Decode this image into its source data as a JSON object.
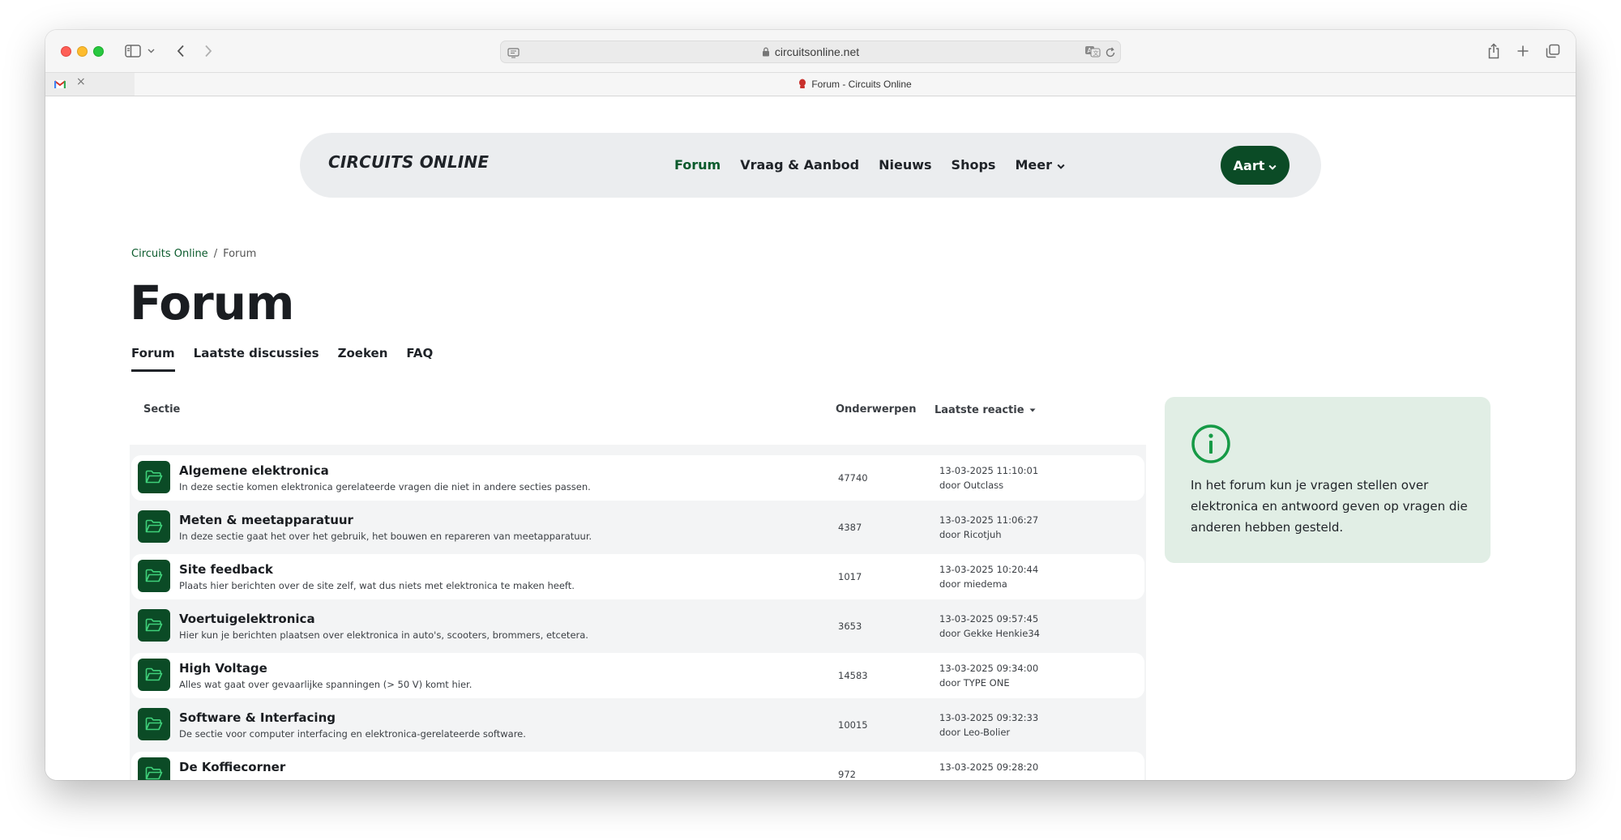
{
  "browser": {
    "url": "circuitsonline.net",
    "tab_title": "Forum - Circuits Online",
    "inactive_tab_close": "×"
  },
  "site": {
    "logo": "CIRCUITS ONLINE",
    "nav": [
      {
        "label": "Forum",
        "active": true
      },
      {
        "label": "Vraag & Aanbod",
        "active": false
      },
      {
        "label": "Nieuws",
        "active": false
      },
      {
        "label": "Shops",
        "active": false
      },
      {
        "label": "Meer",
        "active": false
      }
    ],
    "user_button": "Aart",
    "accent_color": "#0b4b26"
  },
  "breadcrumb": {
    "home": "Circuits Online",
    "separator": "/",
    "current": "Forum"
  },
  "page_title": "Forum",
  "subtabs": [
    {
      "label": "Forum",
      "active": true
    },
    {
      "label": "Laatste discussies",
      "active": false
    },
    {
      "label": "Zoeken",
      "active": false
    },
    {
      "label": "FAQ",
      "active": false
    }
  ],
  "table": {
    "headers": {
      "section": "Sectie",
      "topics": "Onderwerpen",
      "last_reply": "Laatste reactie"
    },
    "rows": [
      {
        "title": "Algemene elektronica",
        "desc": "In deze sectie komen elektronica gerelateerde vragen die niet in andere secties passen.",
        "count": "47740",
        "date": "13-03-2025 11:10:01",
        "by": "door Outclass"
      },
      {
        "title": "Meten & meetapparatuur",
        "desc": "In deze sectie gaat het over het gebruik, het bouwen en repareren van meetapparatuur.",
        "count": "4387",
        "date": "13-03-2025 11:06:27",
        "by": "door Ricotjuh"
      },
      {
        "title": "Site feedback",
        "desc": "Plaats hier berichten over de site zelf, wat dus niets met elektronica te maken heeft.",
        "count": "1017",
        "date": "13-03-2025 10:20:44",
        "by": "door miedema"
      },
      {
        "title": "Voertuigelektronica",
        "desc": "Hier kun je berichten plaatsen over elektronica in auto's, scooters, brommers, etcetera.",
        "count": "3653",
        "date": "13-03-2025 09:57:45",
        "by": "door Gekke Henkie34"
      },
      {
        "title": "High Voltage",
        "desc": "Alles wat gaat over gevaarlijke spanningen (> 50 V) komt hier.",
        "count": "14583",
        "date": "13-03-2025 09:34:00",
        "by": "door TYPE ONE"
      },
      {
        "title": "Software & Interfacing",
        "desc": "De sectie voor computer interfacing en elektronica-gerelateerde software.",
        "count": "10015",
        "date": "13-03-2025 09:32:33",
        "by": "door Leo-Bolier"
      },
      {
        "title": "De Koffiecorner",
        "desc": "",
        "count": "972",
        "date": "13-03-2025 09:28:20",
        "by": ""
      }
    ]
  },
  "info_card": {
    "text": "In het forum kun je vragen stellen over elektronica en antwoord geven op vragen die anderen hebben gesteld."
  }
}
